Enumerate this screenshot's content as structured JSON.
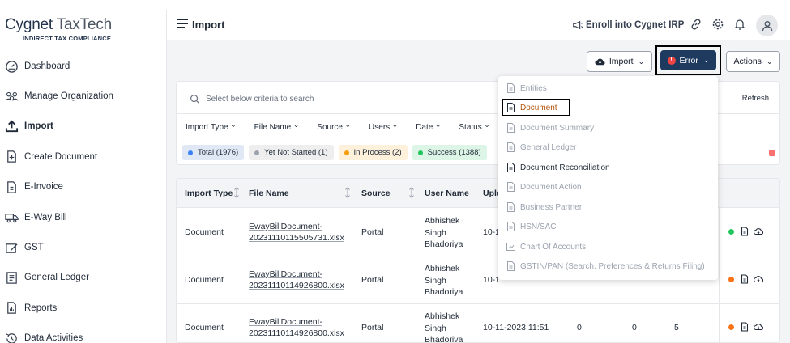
{
  "brand": {
    "name_a": "Cygnet ",
    "name_b": "TaxTech",
    "tagline": "INDIRECT TAX COMPLIANCE"
  },
  "sidebar": {
    "items": [
      {
        "label": "Dashboard",
        "icon": "dashboard-icon"
      },
      {
        "label": "Manage Organization",
        "icon": "organization-icon"
      },
      {
        "label": "Import",
        "icon": "import-icon",
        "active": true
      },
      {
        "label": "Create Document",
        "icon": "document-add-icon"
      },
      {
        "label": "E-Invoice",
        "icon": "invoice-icon"
      },
      {
        "label": "E-Way Bill",
        "icon": "truck-icon"
      },
      {
        "label": "GST",
        "icon": "gst-icon"
      },
      {
        "label": "General Ledger",
        "icon": "ledger-icon"
      },
      {
        "label": "Reports",
        "icon": "reports-icon"
      },
      {
        "label": "Data Activities",
        "icon": "history-icon"
      }
    ]
  },
  "header": {
    "title": "Import",
    "enroll": "Enroll into Cygnet IRP"
  },
  "toolbar": {
    "import_label": "Import",
    "error_label": "Error",
    "actions_label": "Actions"
  },
  "filters": {
    "search_placeholder": "Select below criteria to search",
    "refresh": "Refresh",
    "fields": [
      "Import Type",
      "File Name",
      "Source",
      "Users",
      "Date",
      "Status"
    ],
    "chips": {
      "total": "Total (1976)",
      "not_started": "Yet Not Started (1)",
      "in_process": "In Process (2)",
      "success": "Success (1388)"
    }
  },
  "table": {
    "headers": {
      "import_type": "Import Type",
      "file_name": "File Name",
      "source": "Source",
      "user_name": "User Name",
      "upload": "Uplo"
    },
    "rows": [
      {
        "import_type": "Document",
        "file_line1": "EwayBillDocument-",
        "file_line2": "20231110115505731.xlsx",
        "source": "Portal",
        "user1": "Abhishek",
        "user2": "Singh",
        "user3": "Bhadoriya",
        "date": "10-1",
        "c1": "",
        "c2": "",
        "c3": ""
      },
      {
        "import_type": "Document",
        "file_line1": "EwayBillDocument-",
        "file_line2": "20231110114926800.xlsx",
        "source": "Portal",
        "user1": "Abhishek",
        "user2": "Singh",
        "user3": "Bhadoriya",
        "date": "10-1",
        "c1": "",
        "c2": "",
        "c3": ""
      },
      {
        "import_type": "Document",
        "file_line1": "EwayBillDocument-",
        "file_line2": "20231110114926800.xlsx",
        "source": "Portal",
        "user1": "Abhishek",
        "user2": "Singh",
        "user3": "Bhadoriya",
        "date": "10-11-2023 11:51",
        "c1": "0",
        "c2": "0",
        "c3": "5"
      }
    ]
  },
  "dropdown": {
    "items": [
      {
        "label": "Entities",
        "state": "disabled"
      },
      {
        "label": "Document",
        "state": "selected"
      },
      {
        "label": "Document Summary",
        "state": "disabled"
      },
      {
        "label": "General Ledger",
        "state": "disabled"
      },
      {
        "label": "Document Reconciliation",
        "state": "enabled"
      },
      {
        "label": "Document Action",
        "state": "disabled"
      },
      {
        "label": "Business Partner",
        "state": "disabled"
      },
      {
        "label": "HSN/SAC",
        "state": "disabled"
      },
      {
        "label": "Chart Of Accounts",
        "state": "disabled"
      },
      {
        "label": "GSTIN/PAN (Search, Preferences & Returns Filing)",
        "state": "disabled"
      }
    ]
  },
  "colors": {
    "primary": "#1e3a5f",
    "error": "#ef4444",
    "success": "#22c55e",
    "warning": "#f97316",
    "selected": "#b45309"
  }
}
